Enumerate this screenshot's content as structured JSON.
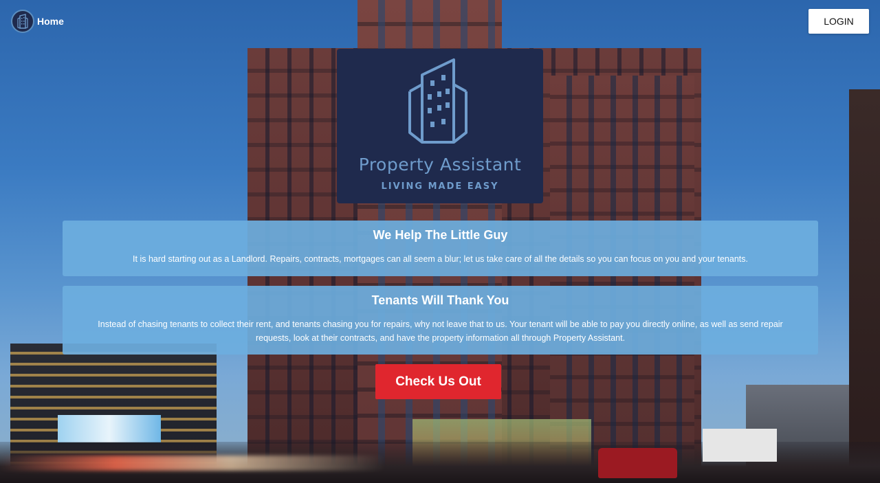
{
  "header": {
    "home_label": "Home",
    "login_label": "LOGIN"
  },
  "logo": {
    "title": "Property Assistant",
    "tagline": "LIVING MADE EASY",
    "icon": "building-icon"
  },
  "panels": [
    {
      "heading": "We Help The Little Guy",
      "body": "It is hard starting out as a Landlord. Repairs, contracts, mortgages can all seem a blur; let us take care of all the details so you can focus on you and your tenants."
    },
    {
      "heading": "Tenants Will Thank You",
      "body": "Instead of chasing tenants to collect their rent, and tenants chasing you for repairs, why not leave that to us. Your tenant will be able to pay you directly online, as well as send repair requests, look at their contracts, and have the property information all through Property Assistant."
    }
  ],
  "cta": {
    "label": "Check Us Out"
  },
  "colors": {
    "navy": "#1f2a4d",
    "logo_blue": "#6f9ccc",
    "panel_blue": "#6caede",
    "cta_red": "#e0262e"
  }
}
